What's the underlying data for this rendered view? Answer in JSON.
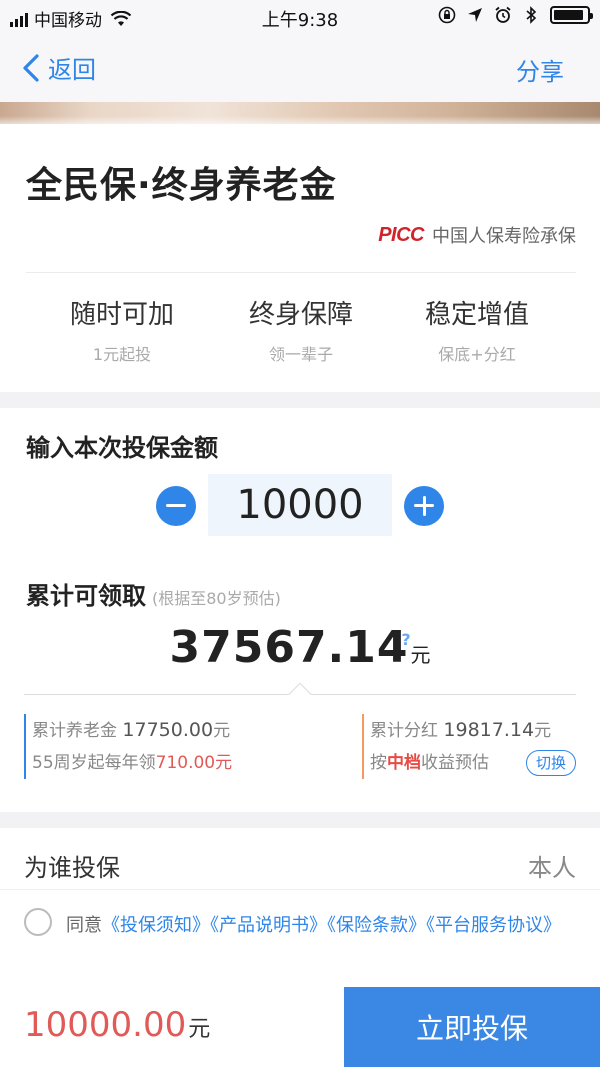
{
  "status_bar": {
    "carrier": "中国移动",
    "time": "上午9:38",
    "battery_level": 0.9
  },
  "nav": {
    "back_label": "返回",
    "share_label": "分享"
  },
  "product": {
    "title": "全民保·终身养老金",
    "insurer_logo": "PICC",
    "insurer_text": "中国人保寿险承保",
    "features": [
      {
        "title": "随时可加",
        "sub": "1元起投"
      },
      {
        "title": "终身保障",
        "sub": "领一辈子"
      },
      {
        "title": "稳定增值",
        "sub": "保底+分红"
      }
    ]
  },
  "amount": {
    "section_title": "输入本次投保金额",
    "value": "10000"
  },
  "receive": {
    "title": "累计可领取",
    "note": "(根据至80岁预估)",
    "total": "37567.14",
    "total_unit": "元",
    "help": "?",
    "left": {
      "pension_label": "累计养老金",
      "pension_value": "17750.00",
      "unit": "元",
      "annual_prefix": "55周岁起每年领",
      "annual_value": "710.00元"
    },
    "right": {
      "dividend_label": "累计分红",
      "dividend_value": "19817.14",
      "unit": "元",
      "basis_prefix": "按",
      "basis_level": "中档",
      "basis_suffix": "收益预估",
      "switch_label": "切换"
    }
  },
  "insured": {
    "label": "为谁投保",
    "value": "本人"
  },
  "agreement": {
    "prefix": "同意",
    "links": [
      "《投保须知》",
      "《产品说明书》",
      "《保险条款》",
      "《平台服务协议》"
    ]
  },
  "footer": {
    "price": "10000.00",
    "price_unit": "元",
    "buy_label": "立即投保"
  },
  "colors": {
    "accent": "#2f86e8",
    "price_red": "#e05a57",
    "picc_red": "#d2232a"
  }
}
